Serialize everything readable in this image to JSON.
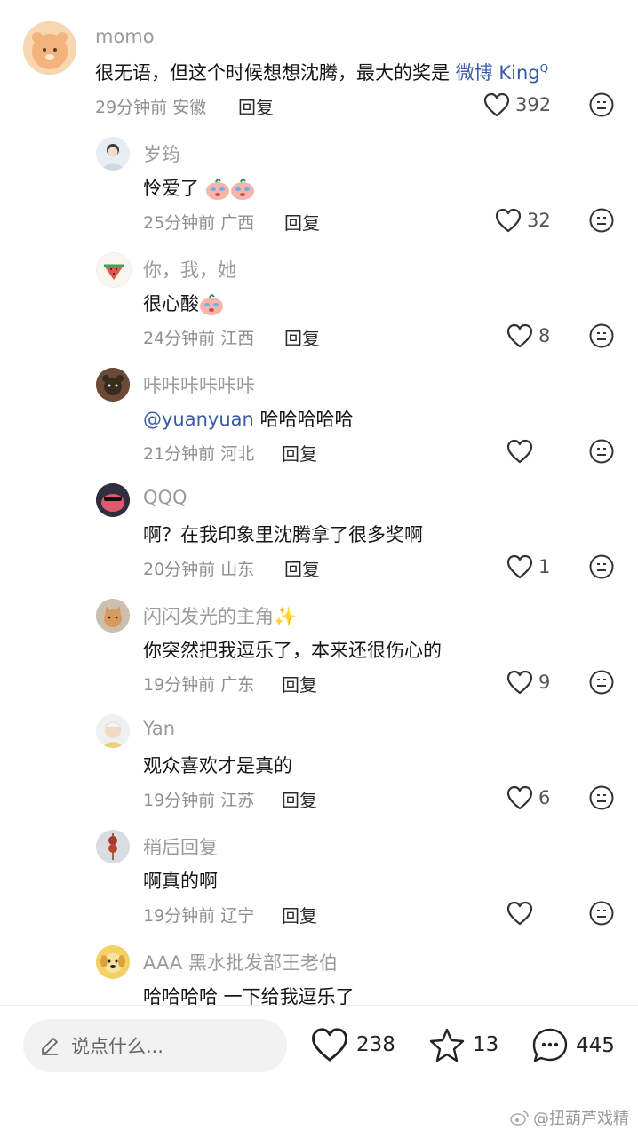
{
  "main_comment": {
    "username": "momo",
    "text": "很无语，但这个时候想想沈腾，最大的奖是 ",
    "link": "微博 King",
    "link_sup": "Q",
    "time": "29分钟前",
    "location": "安徽",
    "reply_label": "回复",
    "likes": "392"
  },
  "replies": [
    {
      "username": "岁筠",
      "text": "怜爱了",
      "time": "25分钟前",
      "location": "广西",
      "reply_label": "回复",
      "likes": "32",
      "emojis": 2
    },
    {
      "username": "你，我，她",
      "text": "很心酸",
      "time": "24分钟前",
      "location": "江西",
      "reply_label": "回复",
      "likes": "8",
      "emojis": 1
    },
    {
      "username": "咔咔咔咔咔咔",
      "mention": "@yuanyuan",
      "text": " 哈哈哈哈哈",
      "time": "21分钟前",
      "location": "河北",
      "reply_label": "回复",
      "likes": ""
    },
    {
      "username": "QQQ",
      "text": "啊？在我印象里沈腾拿了很多奖啊",
      "time": "20分钟前",
      "location": "山东",
      "reply_label": "回复",
      "likes": "1"
    },
    {
      "username": "闪闪发光的主角",
      "username_suffix": "✨",
      "text": "你突然把我逗乐了，本来还很伤心的",
      "time": "19分钟前",
      "location": "广东",
      "reply_label": "回复",
      "likes": "9"
    },
    {
      "username": "Yan",
      "text": "观众喜欢才是真的",
      "time": "19分钟前",
      "location": "江苏",
      "reply_label": "回复",
      "likes": "6"
    },
    {
      "username": "稍后回复",
      "text": "啊真的啊",
      "time": "19分钟前",
      "location": "辽宁",
      "reply_label": "回复",
      "likes": ""
    },
    {
      "username": "AAA 黑水批发部王老伯",
      "text": "哈哈哈哈  一下给我逗乐了"
    }
  ],
  "bottom_bar": {
    "input_placeholder": "说点什么...",
    "likes": "238",
    "favorites": "13",
    "comments": "445"
  },
  "watermark": "@扭葫芦戏精",
  "colors": {
    "link": "#3a5aa8",
    "muted": "#8f8f8f",
    "emoji_face": "#f4a9a0"
  }
}
